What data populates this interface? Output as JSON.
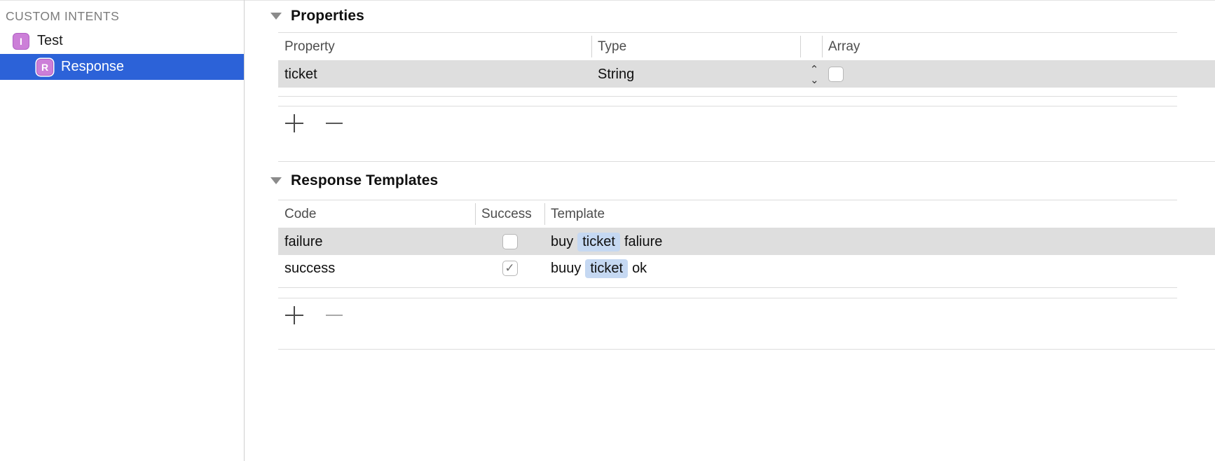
{
  "sidebar": {
    "section_title": "CUSTOM INTENTS",
    "items": [
      {
        "icon_letter": "I",
        "icon_name": "intent-icon",
        "label": "Test",
        "selected": false
      },
      {
        "icon_letter": "R",
        "icon_name": "response-icon",
        "label": "Response",
        "selected": true
      }
    ]
  },
  "properties_section": {
    "title": "Properties",
    "disclosure": "expanded",
    "columns": [
      "Property",
      "Type",
      "Array"
    ],
    "rows": [
      {
        "property": "ticket",
        "type": "String",
        "type_stepper": "up-down-chevron",
        "array_checked": false,
        "selected": true
      }
    ],
    "add_label": "+",
    "remove_label": "—"
  },
  "response_templates_section": {
    "title": "Response Templates",
    "disclosure": "expanded",
    "columns": [
      "Code",
      "Success",
      "Template"
    ],
    "rows": [
      {
        "code": "failure",
        "success_checked": false,
        "template_parts": [
          {
            "text": "buy",
            "token": false
          },
          {
            "text": "ticket",
            "token": true
          },
          {
            "text": "faliure",
            "token": false
          }
        ],
        "selected": true
      },
      {
        "code": "success",
        "success_checked": true,
        "template_parts": [
          {
            "text": "buuy",
            "token": false
          },
          {
            "text": "ticket",
            "token": true
          },
          {
            "text": "ok",
            "token": false
          }
        ],
        "selected": false
      }
    ],
    "add_label": "+",
    "remove_label": "—"
  },
  "colors": {
    "selection_blue": "#2c62d8",
    "row_selected_gray": "#dedede",
    "icon_purple": "#cc7fd8",
    "token_blue": "#c5d8f2"
  }
}
